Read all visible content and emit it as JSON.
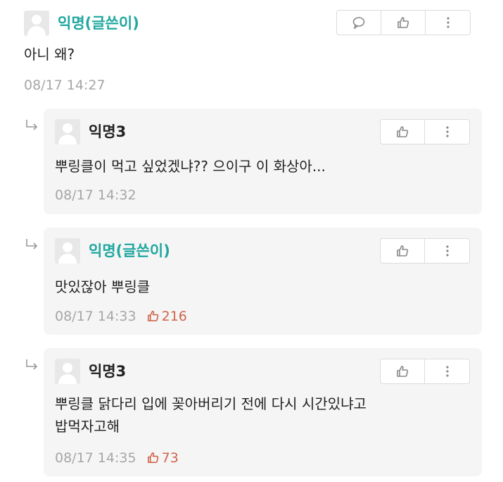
{
  "comments": [
    {
      "author": "익명(글쓴이)",
      "text": "아니 왜?",
      "time": "08/17 14:27"
    }
  ],
  "replies": [
    {
      "author": "익명3",
      "text": "뿌링클이 먹고 싶었겠냐?? 으이구 이 화상아...",
      "time": "08/17 14:32"
    },
    {
      "author": "익명(글쓴이)",
      "text": "맛있잖아 뿌링클",
      "time": "08/17 14:33",
      "likes": "216"
    },
    {
      "author": "익명3",
      "text_line1": "뿌링클 닭다리 입에 꽂아버리기 전에 다시 시간있냐고",
      "text_line2": "밥먹자고해",
      "time": "08/17 14:35",
      "likes": "73"
    }
  ],
  "icons": {
    "comment": "comment-icon",
    "like": "thumbs-up-icon",
    "more": "more-vertical-icon",
    "reply": "reply-arrow-icon",
    "avatar": "avatar-icon"
  },
  "colors": {
    "author_name": "#1fa7a0",
    "likes": "#d0654b",
    "timestamp": "#a6a6a6",
    "reply_bg": "#f5f5f5"
  }
}
